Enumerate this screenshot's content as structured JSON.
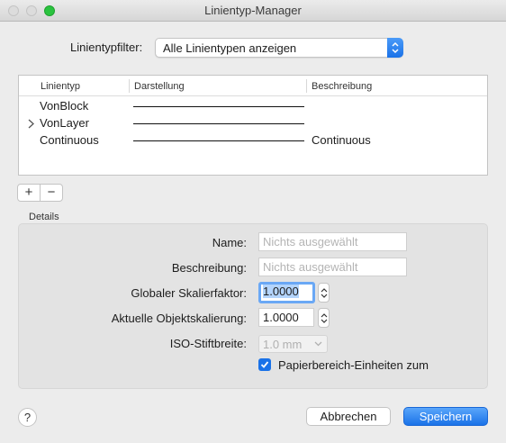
{
  "window": {
    "title": "Linientyp-Manager"
  },
  "filter": {
    "label": "Linientypfilter:",
    "selected": "Alle Linientypen anzeigen"
  },
  "table": {
    "headers": [
      "Linientyp",
      "Darstellung",
      "Beschreibung"
    ],
    "rows": [
      {
        "name": "VonBlock",
        "description": ""
      },
      {
        "name": "VonLayer",
        "description": ""
      },
      {
        "name": "Continuous",
        "description": "Continuous"
      }
    ]
  },
  "toolbar": {
    "add_label": "+",
    "remove_label": "−"
  },
  "details": {
    "section_label": "Details",
    "name_label": "Name:",
    "name_placeholder": "Nichts ausgewählt",
    "desc_label": "Beschreibung:",
    "desc_placeholder": "Nichts ausgewählt",
    "global_scale_label": "Globaler Skalierfaktor:",
    "global_scale_value": "1.0000",
    "object_scale_label": "Aktuelle Objektskalierung:",
    "object_scale_value": "1.0000",
    "iso_label": "ISO-Stiftbreite:",
    "iso_value": "1.0 mm",
    "paper_units_label": "Papierbereich-Einheiten zum",
    "paper_units_checked": true
  },
  "footer": {
    "help_label": "?",
    "cancel_label": "Abbrechen",
    "save_label": "Speichern"
  },
  "colors": {
    "accent": "#1a72e8",
    "zoom_light": "#2ac33f"
  }
}
